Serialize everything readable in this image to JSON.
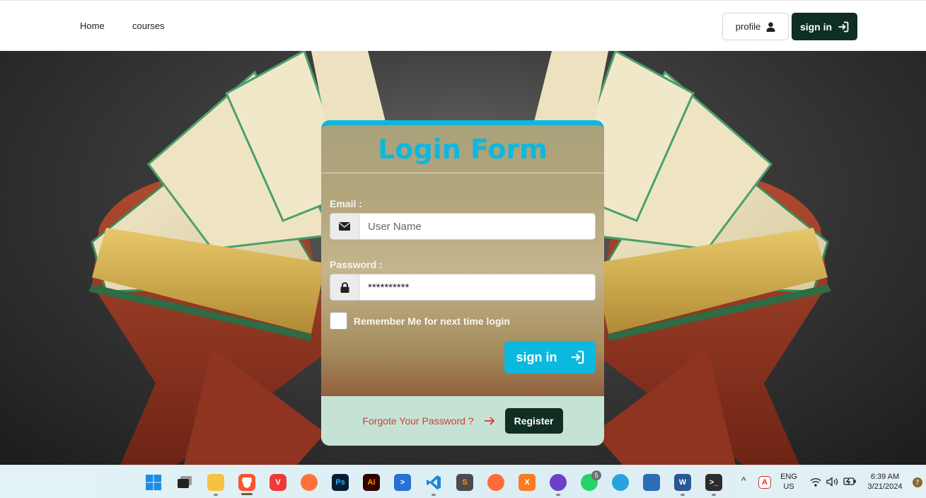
{
  "nav": {
    "home": "Home",
    "courses": "courses",
    "profile_label": "profile",
    "signin_label": "sign in"
  },
  "form": {
    "title": "Login Form",
    "email_label": "Email :",
    "email_placeholder": "User Name",
    "password_label": "Password :",
    "password_value": "**********",
    "remember_label": "Remember Me for next time login",
    "signin_label": "sign in",
    "forgot_label": "Forgote Your Password ?",
    "register_label": "Register"
  },
  "taskbar": {
    "apps": [
      "windows-start",
      "task-view",
      "file-explorer",
      "brave-browser",
      "vivaldi-browser",
      "firefox",
      "photoshop",
      "illustrator",
      "powershell",
      "vscode",
      "sublime-text",
      "postman",
      "xampp",
      "github-desktop",
      "whatsapp",
      "telegram",
      "notepad",
      "word",
      "terminal"
    ],
    "whatsapp_badge": "5",
    "lang": "ENG",
    "region": "US",
    "time": "6:39 AM",
    "date": "3/21/2024",
    "notification_count": "7"
  },
  "colors": {
    "accent": "#0bb8e0",
    "dark_green": "#0f2f22",
    "footer_bg": "#c5e3d4",
    "forgot_red": "#d43a3a"
  }
}
